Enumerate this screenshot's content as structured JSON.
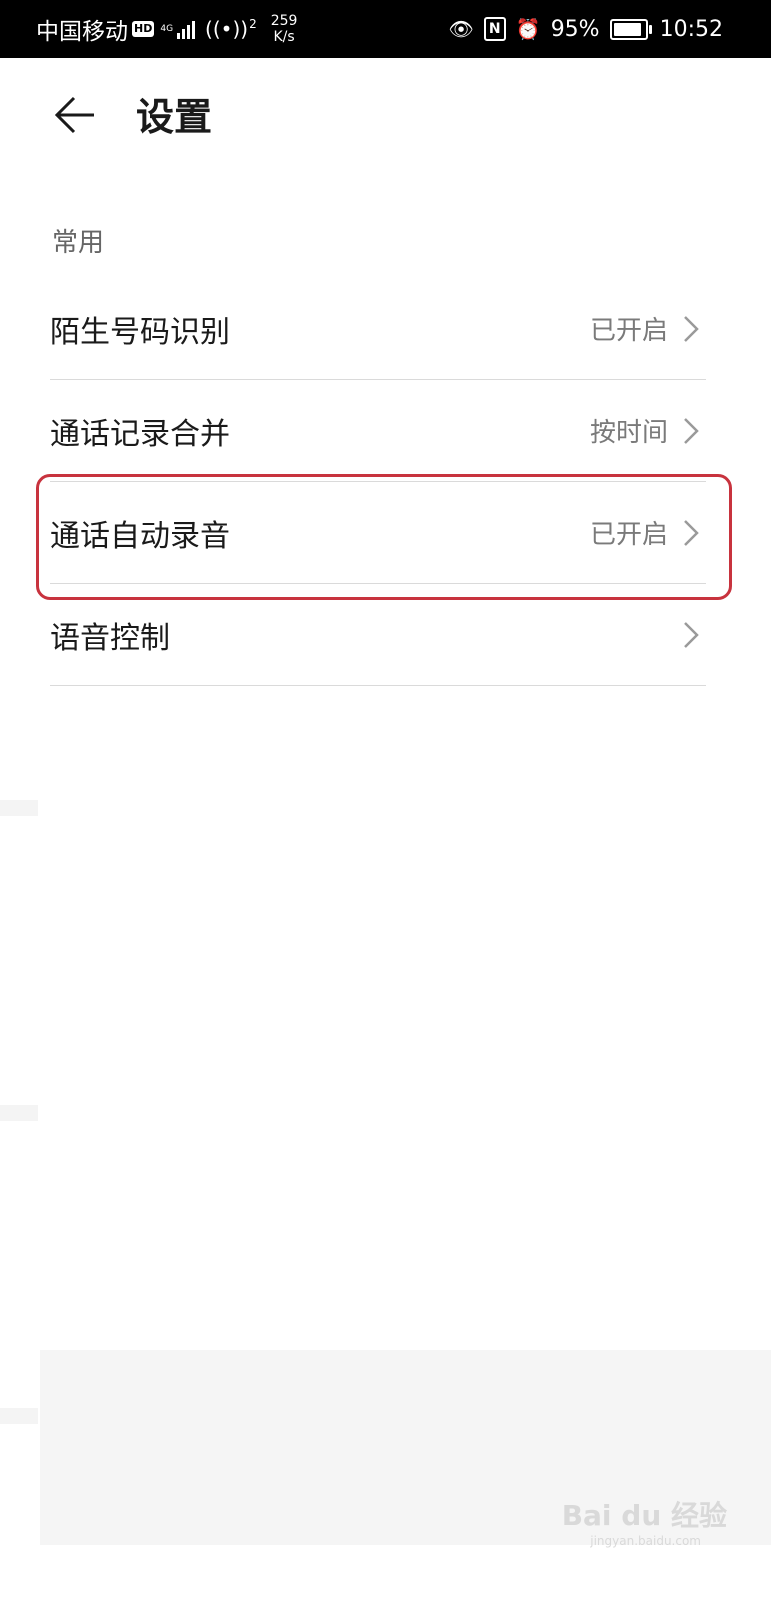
{
  "status_bar": {
    "carrier": "中国移动",
    "hd_badge": "HD",
    "network_type": "4G",
    "hotspot_count": "2",
    "speed_value": "259",
    "speed_unit": "K/s",
    "battery_percent": "95%",
    "battery_level": 0.95,
    "time": "10:52",
    "icons": [
      "eye-icon",
      "nfc-icon",
      "alarm-icon",
      "battery-icon",
      "signal-icon",
      "hotspot-icon"
    ]
  },
  "header": {
    "back_icon": "back-arrow-icon",
    "title": "设置"
  },
  "section": {
    "label": "常用"
  },
  "settings": [
    {
      "label": "陌生号码识别",
      "value": "已开启"
    },
    {
      "label": "通话记录合并",
      "value": "按时间"
    },
    {
      "label": "通话自动录音",
      "value": "已开启"
    },
    {
      "label": "语音控制",
      "value": ""
    }
  ],
  "highlight_color": "#c8333e",
  "watermark": {
    "text": "Bai du 经验",
    "url": "jingyan.baidu.com"
  }
}
